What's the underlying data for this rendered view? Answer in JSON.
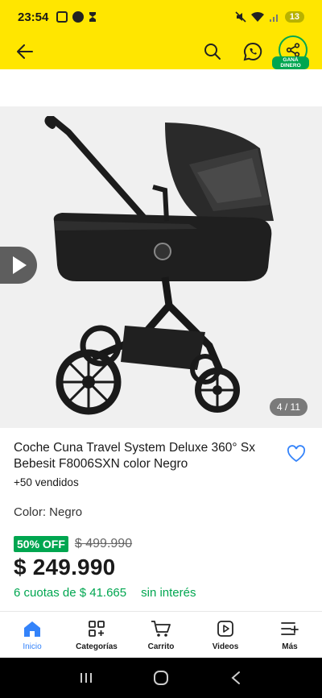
{
  "status_bar": {
    "time": "23:54",
    "battery_level": "13"
  },
  "app_bar": {
    "gana_badge": "GANÁ DINERO"
  },
  "gallery": {
    "counter": "4 / 11"
  },
  "product": {
    "title": "Coche Cuna Travel System Deluxe 360° Sx Bebesit F8006SXN color Negro",
    "sold": "+50 vendidos",
    "color_label": "Color: Negro",
    "discount": "50% OFF",
    "old_price": "$ 499.990",
    "price": "$ 249.990",
    "installments": "6 cuotas de $ 41.665",
    "interest": "sin interés"
  },
  "bottom_nav": {
    "items": [
      {
        "label": "Inicio",
        "icon": "home-icon",
        "active": true
      },
      {
        "label": "Categorías",
        "icon": "categories-icon",
        "active": false
      },
      {
        "label": "Carrito",
        "icon": "cart-icon",
        "active": false
      },
      {
        "label": "Videos",
        "icon": "videos-icon",
        "active": false
      },
      {
        "label": "Más",
        "icon": "more-icon",
        "active": false
      }
    ]
  },
  "colors": {
    "brand_yellow": "#ffe600",
    "accent_green": "#00a650",
    "accent_blue": "#3483fa"
  }
}
